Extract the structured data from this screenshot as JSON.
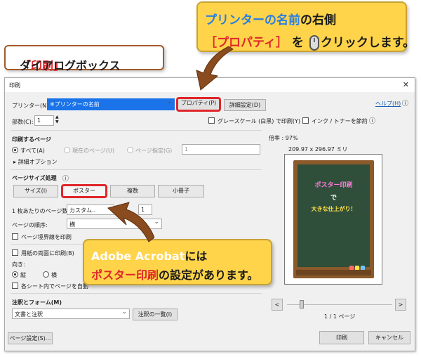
{
  "callouts": {
    "top": {
      "line1_prefix": "プリンターの名前",
      "line1_suffix": "の右側",
      "line2_highlight": "［プロパティ］",
      "line2_mid": "を",
      "line2_suffix": "クリックします。"
    },
    "dialog_label": {
      "highlight": "「印刷」",
      "suffix": "ダイアログボックス"
    },
    "mid": {
      "line1_highlight": "Adobe Acrobat",
      "line1_suffix": "には",
      "line2_highlight": "ポスター印刷",
      "line2_suffix": "の設定があります。"
    }
  },
  "dialog": {
    "title": "印刷",
    "close": "✕",
    "printer_label": "プリンター(N):",
    "printer_value": "※プリンターの名前",
    "properties_button": "プロパティ(P)",
    "advanced_button": "詳細設定(D)",
    "help_link": "ヘルプ(H)",
    "copies_label": "部数(C):",
    "copies_value": "1",
    "grayscale_label": "グレースケール (白黒) で印刷(Y)",
    "ink_saver_label": "インク / トナーを節約",
    "pages_section": "印刷するページ",
    "radio_all": "すべて(A)",
    "radio_current": "現在のページ(U)",
    "radio_range": "ページ指定(G)",
    "range_value": "1",
    "more_options": "詳細オプション",
    "sizing_section": "ページサイズ処理",
    "tab_size": "サイズ(I)",
    "tab_poster": "ポスター",
    "tab_multiple": "複数",
    "tab_booklet": "小冊子",
    "pages_per_sheet_label": "1 枚あたりのページ数:",
    "pages_per_sheet_value": "カスタム..",
    "pages_per_sheet_num": "1",
    "page_order_label": "ページの順序:",
    "page_order_value": "横",
    "print_border_label": "ページ境界線を印刷",
    "duplex_label": "用紙の両面に印刷(B)",
    "orientation_label": "向き:",
    "orient_portrait": "縦",
    "orient_landscape": "横",
    "auto_rotate_label": "各シート内でページを自動",
    "comments_section": "注釈とフォーム(M)",
    "comments_value": "文書と注釈",
    "summarize_button": "注釈の一覧(I)",
    "scale_label": "倍率 : 97%",
    "dims_label": "209.97 x 296.97 ミリ",
    "prev_button": "<",
    "next_button": ">",
    "page_count": "1 / 1 ページ",
    "page_setup_button": "ページ設定(S)...",
    "print_button": "印刷",
    "cancel_button": "キャンセル"
  },
  "preview": {
    "line1": "ポスター印刷",
    "line2": "で",
    "line3": "大きな仕上がり！"
  },
  "colors": {
    "callout_bg": "#ffd44a",
    "highlight_red": "#e0262a",
    "accent_blue": "#2a7de1",
    "printer_select": "#1a73e8"
  }
}
